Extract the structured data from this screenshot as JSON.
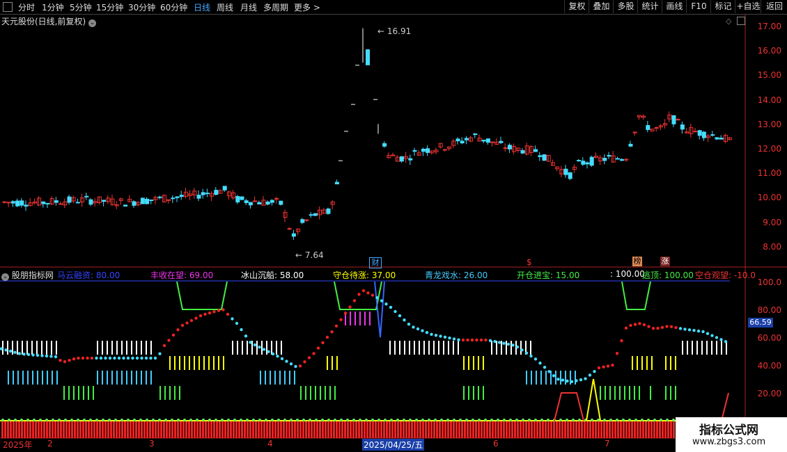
{
  "toolbar": {
    "periods": [
      "分时",
      "1分钟",
      "5分钟",
      "15分钟",
      "30分钟",
      "60分钟",
      "日线",
      "周线",
      "月线",
      "多周期",
      "更多 >"
    ],
    "active_period": "日线",
    "buttons": [
      "复权",
      "叠加",
      "多股",
      "统计",
      "画线",
      "F10",
      "标记",
      "+自选",
      "返回"
    ]
  },
  "main": {
    "title": "天元股份(日线,前复权)",
    "high_label": "16.91",
    "low_label": "7.64",
    "price_ticks": [
      "17.00",
      "16.00",
      "15.00",
      "14.00",
      "13.00",
      "12.00",
      "11.00",
      "10.00",
      "9.00",
      "8.00"
    ],
    "markers": [
      {
        "text": "财",
        "color": "#4af"
      },
      {
        "text": "$",
        "color": "#e33"
      },
      {
        "text": "榜",
        "color": "#fa4"
      },
      {
        "text": "涨",
        "color": "#e33"
      }
    ]
  },
  "indicator": {
    "name": "股朋指标网",
    "labels": [
      {
        "text": "马云融资: 80.00",
        "color": "#3344ff"
      },
      {
        "text": "丰收在望: 69.00",
        "color": "#e3e"
      },
      {
        "text": "冰山沉船: 58.00",
        "color": "#ffffff"
      },
      {
        "text": "守仓待涨: 37.00",
        "color": "#ff0"
      },
      {
        "text": "青龙戏水: 26.00",
        "color": "#4cf"
      },
      {
        "text": "开仓进宝: 15.00",
        "color": "#4e4"
      },
      {
        "text": ": 100.00",
        "color": "#ffffff"
      },
      {
        "text": "逃顶: 100.00",
        "color": "#4e4"
      },
      {
        "text": "空仓观望: -10.0",
        "color": "#e33"
      }
    ],
    "ticks": [
      "100.0",
      "80.00",
      "60.00",
      "40.00",
      "20.00"
    ],
    "current_value": "66.59"
  },
  "timeline": {
    "labels": [
      "2025年",
      "2",
      "3",
      "4",
      "2025/04/25/五",
      "6",
      "7"
    ]
  },
  "watermark": {
    "title": "指标公式网",
    "url": "www.zbgs3.com"
  }
}
